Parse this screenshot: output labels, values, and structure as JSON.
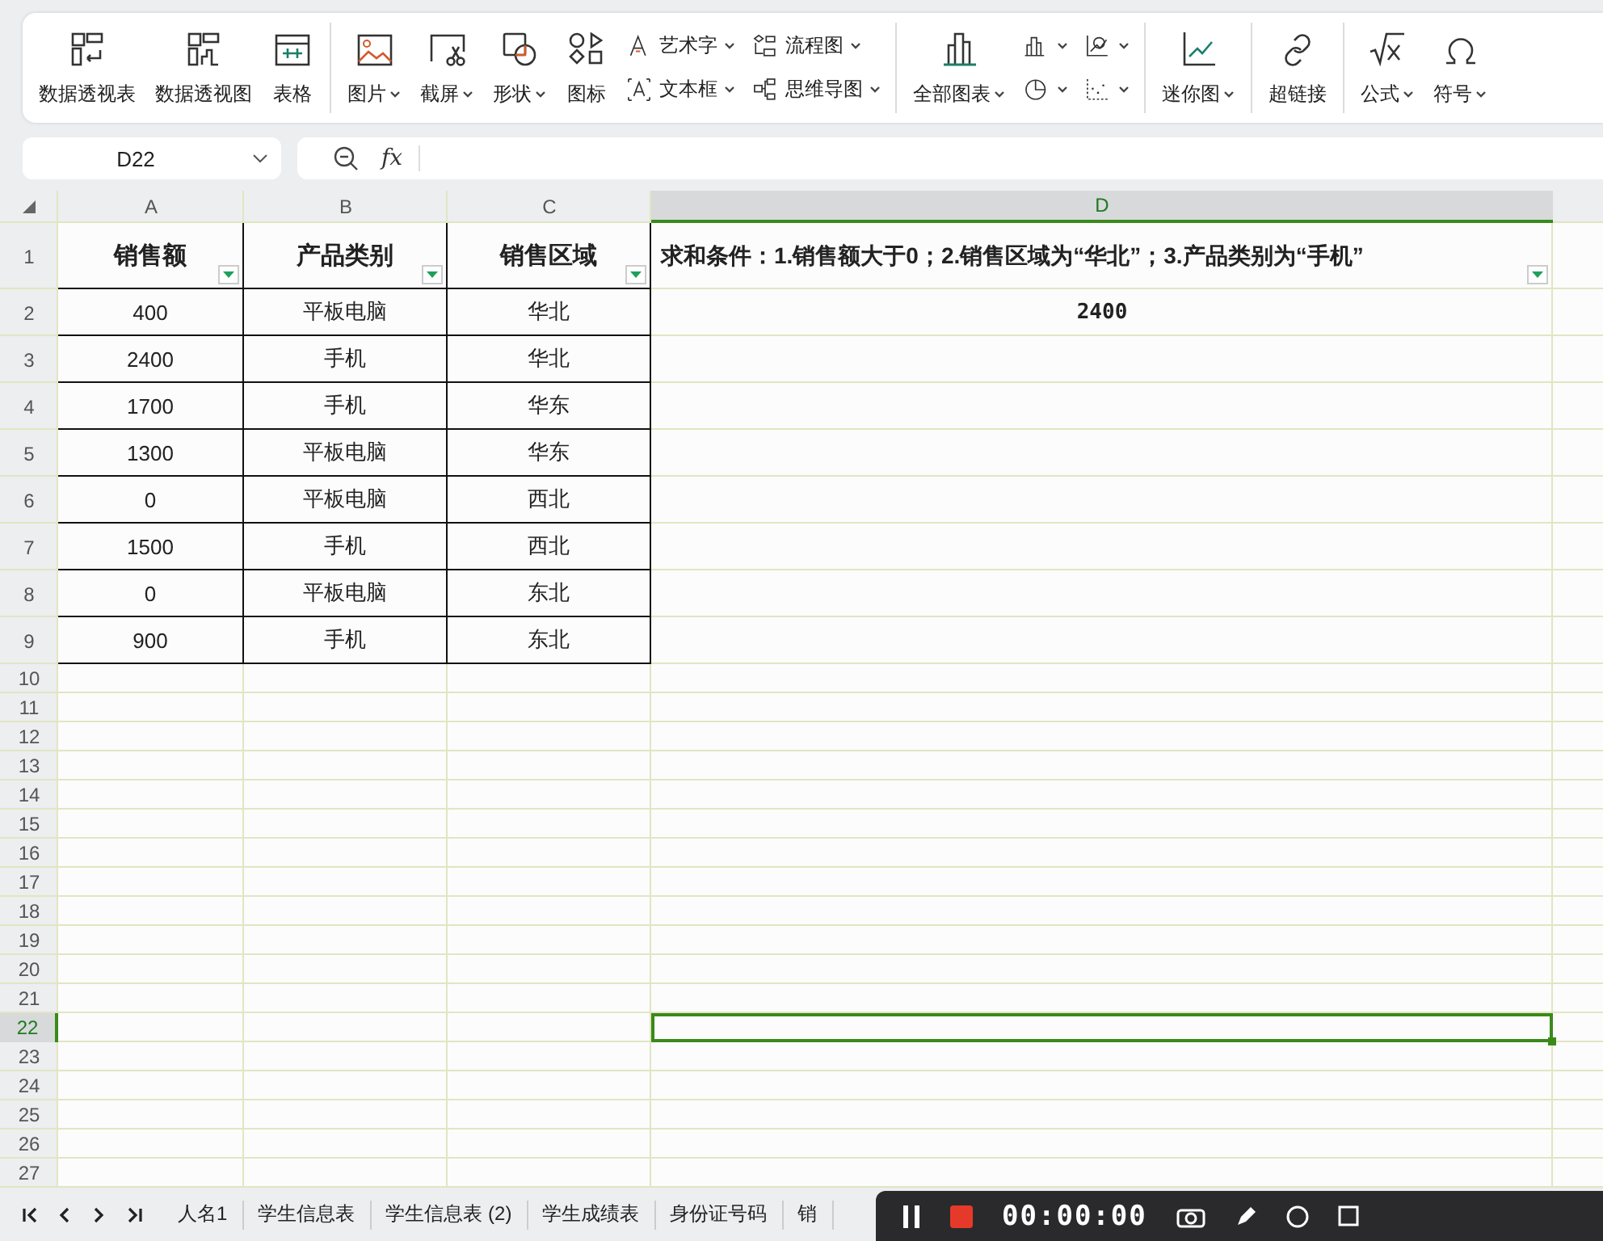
{
  "ribbon": {
    "groups": [
      {
        "columns": [
          {
            "kind": "large",
            "label": "数据透视表",
            "dropdown": false
          },
          {
            "kind": "large",
            "label": "数据透视图",
            "dropdown": false
          },
          {
            "kind": "large",
            "label": "表格",
            "dropdown": false
          }
        ]
      },
      {
        "columns": [
          {
            "kind": "large",
            "label": "图片",
            "dropdown": true
          },
          {
            "kind": "large",
            "label": "截屏",
            "dropdown": true
          },
          {
            "kind": "large",
            "label": "形状",
            "dropdown": true
          },
          {
            "kind": "large",
            "label": "图标",
            "dropdown": false
          },
          {
            "kind": "stack",
            "items": [
              {
                "label": "艺术字",
                "dropdown": true
              },
              {
                "label": "文本框",
                "dropdown": true
              }
            ]
          },
          {
            "kind": "stack",
            "items": [
              {
                "label": "流程图",
                "dropdown": true
              },
              {
                "label": "思维导图",
                "dropdown": true
              }
            ]
          }
        ]
      },
      {
        "columns": [
          {
            "kind": "large",
            "label": "全部图表",
            "dropdown": true
          },
          {
            "kind": "stack",
            "items": [
              {
                "dropdown": true
              },
              {
                "dropdown": true
              }
            ]
          },
          {
            "kind": "stack",
            "items": [
              {
                "dropdown": true
              },
              {
                "dropdown": true
              }
            ]
          }
        ]
      },
      {
        "columns": [
          {
            "kind": "large",
            "label": "迷你图",
            "dropdown": true
          }
        ]
      },
      {
        "columns": [
          {
            "kind": "large",
            "label": "超链接",
            "dropdown": false
          }
        ]
      },
      {
        "columns": [
          {
            "kind": "large",
            "label": "公式",
            "dropdown": true
          },
          {
            "kind": "large",
            "label": "符号",
            "dropdown": true
          }
        ]
      }
    ]
  },
  "formula_bar": {
    "name_box": "D22",
    "fx": "fx"
  },
  "sheet": {
    "columns": [
      {
        "label": "A",
        "selected": false
      },
      {
        "label": "B",
        "selected": false
      },
      {
        "label": "C",
        "selected": false
      },
      {
        "label": "D",
        "selected": true
      }
    ],
    "rows": [
      {
        "label": "1",
        "selected": false,
        "cells": [
          {
            "text": "销售额",
            "filter": true
          },
          {
            "text": "产品类别",
            "filter": true
          },
          {
            "text": "销售区域",
            "filter": true
          },
          {
            "text": "求和条件：1.销售额大于0；2.销售区域为“华北”；3.产品类别为“手机”",
            "filter": true
          }
        ]
      },
      {
        "label": "2",
        "selected": false,
        "cells": [
          {
            "text": "400"
          },
          {
            "text": "平板电脑"
          },
          {
            "text": "华北"
          },
          {
            "text": "2400"
          }
        ]
      },
      {
        "label": "3",
        "selected": false,
        "cells": [
          {
            "text": "2400"
          },
          {
            "text": "手机"
          },
          {
            "text": "华北"
          }
        ]
      },
      {
        "label": "4",
        "selected": false,
        "cells": [
          {
            "text": "1700"
          },
          {
            "text": "手机"
          },
          {
            "text": "华东"
          }
        ]
      },
      {
        "label": "5",
        "selected": false,
        "cells": [
          {
            "text": "1300"
          },
          {
            "text": "平板电脑"
          },
          {
            "text": "华东"
          }
        ]
      },
      {
        "label": "6",
        "selected": false,
        "cells": [
          {
            "text": "0"
          },
          {
            "text": "平板电脑"
          },
          {
            "text": "西北"
          }
        ]
      },
      {
        "label": "7",
        "selected": false,
        "cells": [
          {
            "text": "1500"
          },
          {
            "text": "手机"
          },
          {
            "text": "西北"
          }
        ]
      },
      {
        "label": "8",
        "selected": false,
        "cells": [
          {
            "text": "0"
          },
          {
            "text": "平板电脑"
          },
          {
            "text": "东北"
          }
        ]
      },
      {
        "label": "9",
        "selected": false,
        "cells": [
          {
            "text": "900"
          },
          {
            "text": "手机"
          },
          {
            "text": "东北"
          }
        ]
      },
      {
        "label": "10",
        "selected": false
      },
      {
        "label": "11",
        "selected": false
      },
      {
        "label": "12",
        "selected": false
      },
      {
        "label": "13",
        "selected": false
      },
      {
        "label": "14",
        "selected": false
      },
      {
        "label": "15",
        "selected": false
      },
      {
        "label": "16",
        "selected": false
      },
      {
        "label": "17",
        "selected": false
      },
      {
        "label": "18",
        "selected": false
      },
      {
        "label": "19",
        "selected": false
      },
      {
        "label": "20",
        "selected": false
      },
      {
        "label": "21",
        "selected": false
      },
      {
        "label": "22",
        "selected": true
      },
      {
        "label": "23",
        "selected": false
      },
      {
        "label": "24",
        "selected": false
      },
      {
        "label": "25",
        "selected": false
      },
      {
        "label": "26",
        "selected": false
      },
      {
        "label": "27",
        "selected": false
      }
    ]
  },
  "sheet_tabs": [
    {
      "label": "人名1",
      "selected": false
    },
    {
      "label": "学生信息表",
      "selected": false
    },
    {
      "label": "学生信息表 (2)",
      "selected": false
    },
    {
      "label": "学生成绩表",
      "selected": false
    },
    {
      "label": "身份证号码",
      "selected": false
    },
    {
      "label": "销",
      "selected": false
    }
  ],
  "recorder": {
    "timer": "00:00:00"
  }
}
